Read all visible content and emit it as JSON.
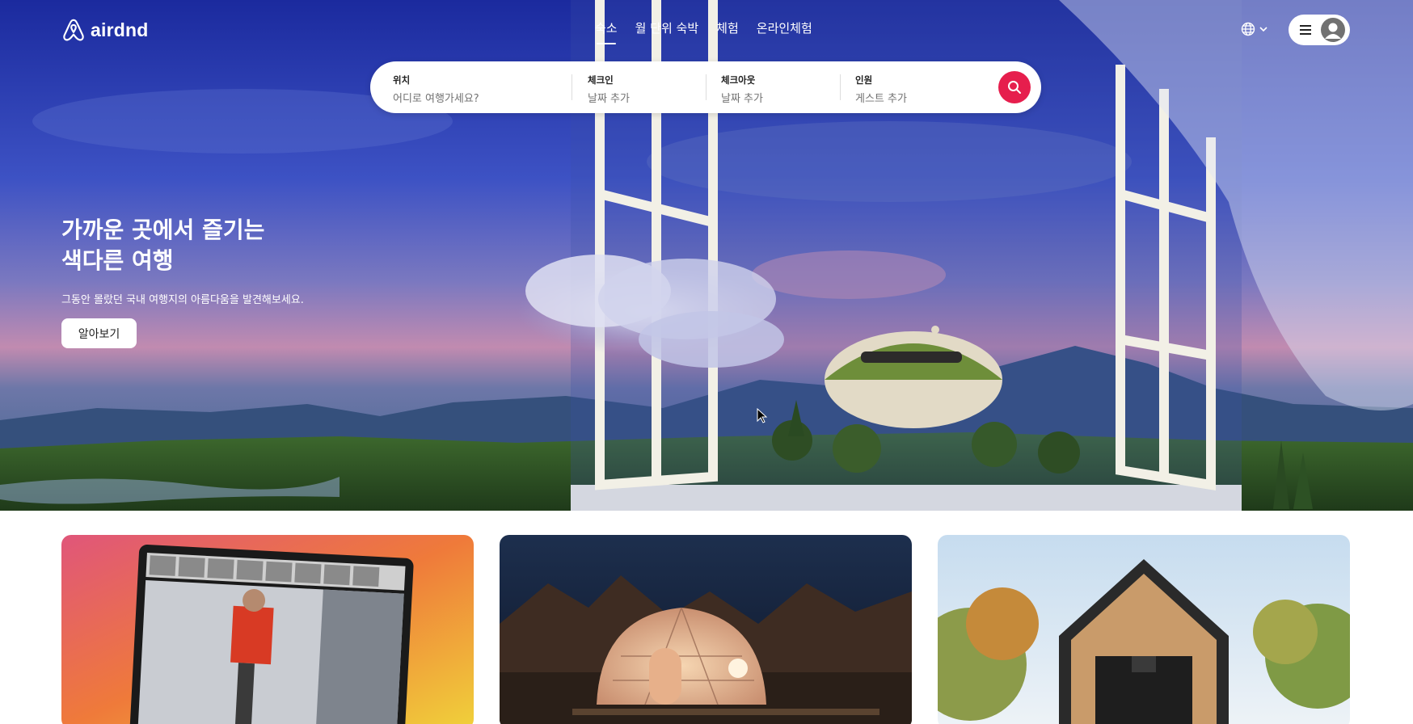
{
  "brand": {
    "name": "airdnd"
  },
  "nav": {
    "items": [
      {
        "label": "숙소",
        "active": true
      },
      {
        "label": "월 단위 숙박",
        "active": false
      },
      {
        "label": "체험",
        "active": false
      },
      {
        "label": "온라인체험",
        "active": false
      }
    ]
  },
  "search": {
    "location": {
      "label": "위치",
      "placeholder": "어디로 여행가세요?"
    },
    "checkin": {
      "label": "체크인",
      "placeholder": "날짜 추가"
    },
    "checkout": {
      "label": "체크아웃",
      "placeholder": "날짜 추가"
    },
    "guests": {
      "label": "인원",
      "placeholder": "게스트 추가"
    }
  },
  "hero": {
    "title_line1": "가까운 곳에서 즐기는",
    "title_line2": "색다른 여행",
    "subtitle": "그동안 몰랐던 국내 여행지의 아름다움을 발견해보세요.",
    "cta": "알아보기"
  },
  "colors": {
    "accent": "#e61e4d",
    "text": "#222222",
    "muted": "#717171"
  },
  "icons": {
    "logo": "airdnd-logo-icon",
    "language": "globe-icon",
    "menu": "menu-icon",
    "avatar": "user-avatar-icon",
    "search": "search-icon"
  }
}
